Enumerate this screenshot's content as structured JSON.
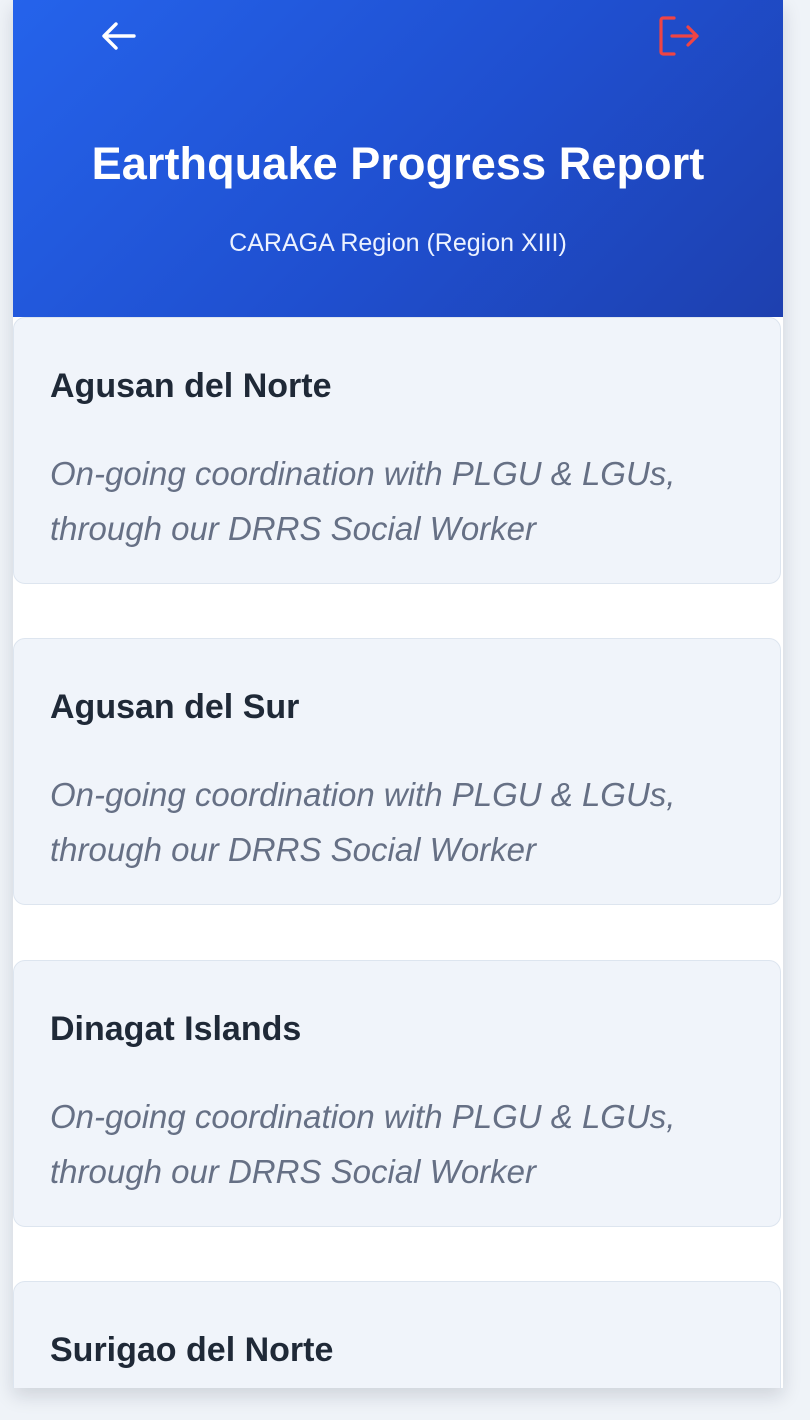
{
  "header": {
    "title": "Earthquake Progress Report",
    "subtitle": "CARAGA Region (Region XIII)",
    "back_icon": "arrow-left-icon",
    "logout_icon": "logout-icon",
    "accent_color": "#2563eb",
    "logout_color": "#ef4444"
  },
  "reports": [
    {
      "province": "Agusan del Norte",
      "status": "On-going coordination with PLGU & LGUs, through our DRRS Social Worker"
    },
    {
      "province": "Agusan del Sur",
      "status": "On-going coordination with PLGU & LGUs, through our DRRS Social Worker"
    },
    {
      "province": "Dinagat Islands",
      "status": "On-going coordination with PLGU & LGUs, through our DRRS Social Worker"
    },
    {
      "province": "Surigao del Norte"
    }
  ]
}
